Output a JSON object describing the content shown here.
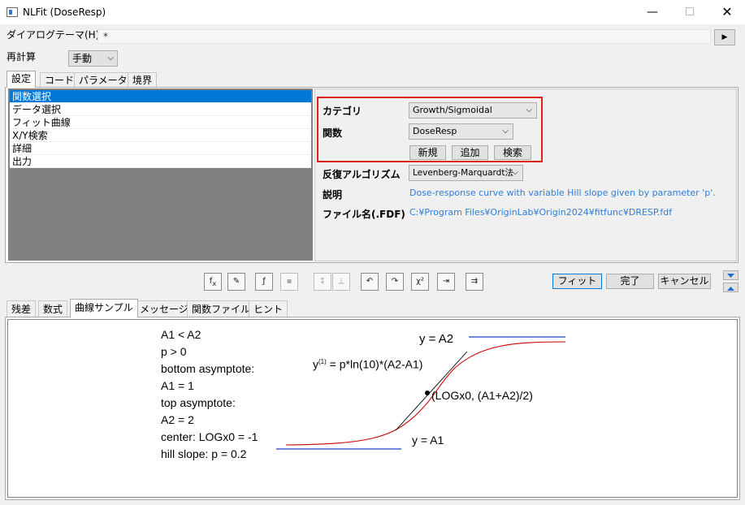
{
  "window": {
    "title": "NLFit (DoseResp)",
    "minimize": "—",
    "close": "✕"
  },
  "theme": {
    "label": "ダイアログテーマ(H)",
    "value": "*",
    "arrow": "▶"
  },
  "recalc": {
    "label": "再計算",
    "value": "手動"
  },
  "top_tabs": [
    "設定",
    "コード",
    "パラメータ",
    "境界"
  ],
  "settings_list": [
    "関数選択",
    "データ選択",
    "フィット曲線",
    "X/Y検索",
    "詳細",
    "出力"
  ],
  "function_panel": {
    "category_label": "カテゴリ",
    "category_value": "Growth/Sigmoidal",
    "function_label": "関数",
    "function_value": "DoseResp",
    "new_button": "新規",
    "add_button": "追加",
    "search_button": "検索",
    "algorithm_label": "反復アルゴリズム",
    "algorithm_value": "Levenberg-Marquardt法",
    "description_label": "説明",
    "description_value": "Dose-response curve with variable Hill slope given by parameter 'p'.",
    "file_label": "ファイル名(.FDF)",
    "file_value": "C:¥Program Files¥OriginLab¥Origin2024¥fitfunc¥DRESP.fdf",
    "highlight_color": "#e0201c"
  },
  "toolbar": {
    "fit_button": "フィット",
    "done_button": "完了",
    "cancel_button": "キャンセル"
  },
  "bottom_tabs": [
    "残差",
    "数式",
    "曲線サンプル",
    "メッセージ",
    "関数ファイル",
    "ヒント"
  ],
  "sample": {
    "notes": [
      "A1 < A2",
      "p > 0",
      "bottom asymptote:",
      "A1 = 1",
      "top asymptote:",
      "A2 = 2",
      "center: LOGx0 = -1",
      "hill slope: p = 0.2"
    ],
    "top_label": "y = A2",
    "slope_label_prefix": "y",
    "slope_label_sup": "(1)",
    "slope_label_rest": " = p*ln(10)*(A2-A1)",
    "center_label": "(LOGx0, (A1+A2)/2)",
    "bottom_label": "y = A1",
    "curve_color": "#cc0000",
    "asymptote_color": "#1f3fbf"
  }
}
